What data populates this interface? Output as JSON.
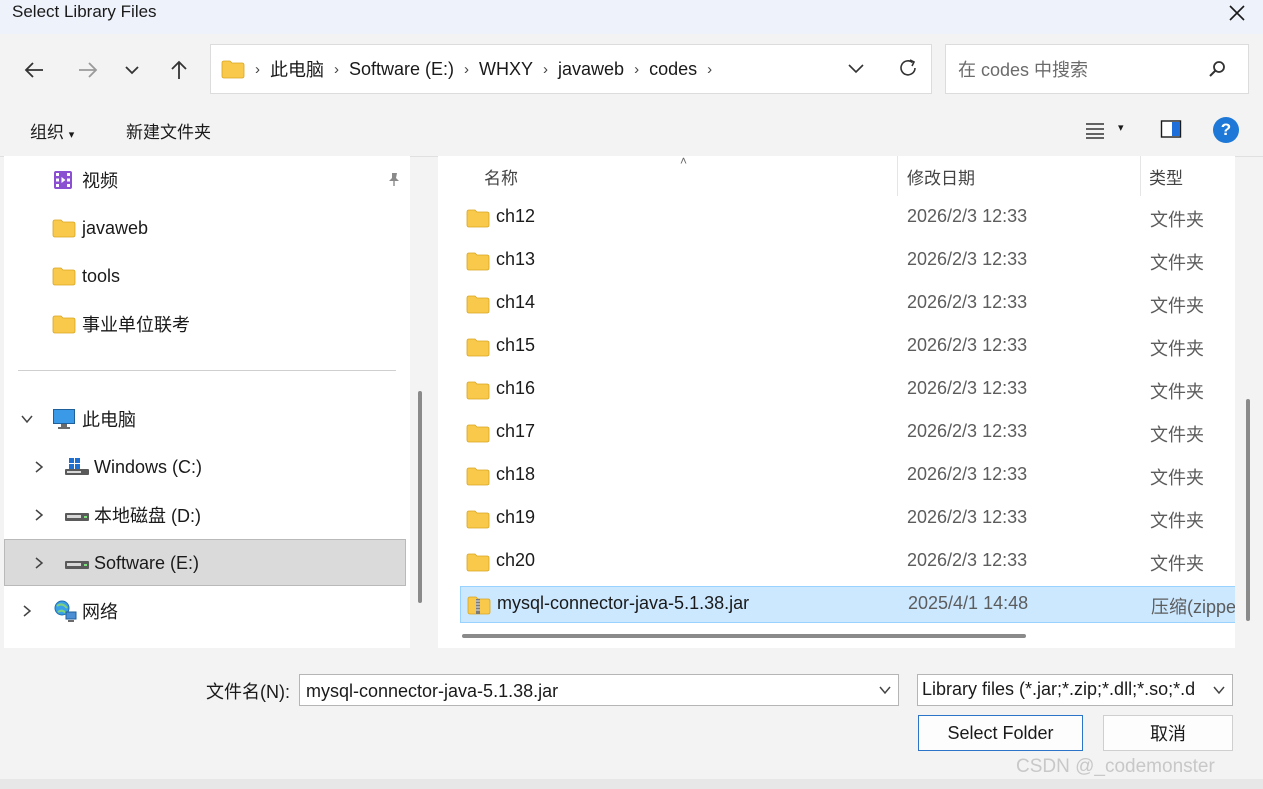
{
  "window": {
    "title": "Select Library Files"
  },
  "address_bar": {
    "crumbs": [
      "此电脑",
      "Software (E:)",
      "WHXY",
      "javaweb",
      "codes"
    ]
  },
  "search": {
    "placeholder": "在 codes 中搜索"
  },
  "command_bar": {
    "organize_label": "组织",
    "new_folder_label": "新建文件夹"
  },
  "sidebar": {
    "quick_access": [
      {
        "label": "视频",
        "icon": "video-folder-icon"
      },
      {
        "label": "javaweb",
        "icon": "folder-icon"
      },
      {
        "label": "tools",
        "icon": "folder-icon"
      },
      {
        "label": "事业单位联考",
        "icon": "folder-icon"
      }
    ],
    "this_pc": {
      "label": "此电脑",
      "icon": "computer-icon"
    },
    "drives": [
      {
        "label": "Windows (C:)",
        "icon": "windows-drive-icon"
      },
      {
        "label": "本地磁盘 (D:)",
        "icon": "drive-icon"
      },
      {
        "label": "Software (E:)",
        "icon": "drive-icon",
        "selected": true
      }
    ],
    "network": {
      "label": "网络",
      "icon": "network-icon"
    }
  },
  "file_list": {
    "columns": {
      "name": "名称",
      "modified": "修改日期",
      "type": "类型"
    },
    "rows": [
      {
        "name": "ch12",
        "modified": "2026/2/3 12:33",
        "type": "文件夹",
        "icon": "folder-icon"
      },
      {
        "name": "ch13",
        "modified": "2026/2/3 12:33",
        "type": "文件夹",
        "icon": "folder-icon"
      },
      {
        "name": "ch14",
        "modified": "2026/2/3 12:33",
        "type": "文件夹",
        "icon": "folder-icon"
      },
      {
        "name": "ch15",
        "modified": "2026/2/3 12:33",
        "type": "文件夹",
        "icon": "folder-icon"
      },
      {
        "name": "ch16",
        "modified": "2026/2/3 12:33",
        "type": "文件夹",
        "icon": "folder-icon"
      },
      {
        "name": "ch17",
        "modified": "2026/2/3 12:33",
        "type": "文件夹",
        "icon": "folder-icon"
      },
      {
        "name": "ch18",
        "modified": "2026/2/3 12:33",
        "type": "文件夹",
        "icon": "folder-icon"
      },
      {
        "name": "ch19",
        "modified": "2026/2/3 12:33",
        "type": "文件夹",
        "icon": "folder-icon"
      },
      {
        "name": "ch20",
        "modified": "2026/2/3 12:33",
        "type": "文件夹",
        "icon": "folder-icon"
      },
      {
        "name": "mysql-connector-java-5.1.38.jar",
        "modified": "2025/4/1 14:48",
        "type": "压缩(zippe",
        "icon": "zip-file-icon",
        "selected": true
      }
    ]
  },
  "bottom": {
    "filename_label": "文件名(N):",
    "filename_value": "mysql-connector-java-5.1.38.jar",
    "filter_value": "Library files (*.jar;*.zip;*.dll;*.so;*.d",
    "select_folder_label": "Select Folder",
    "cancel_label": "取消"
  },
  "watermark": "CSDN @_codemonster",
  "colors": {
    "accent": "#2b74c7",
    "selection": "#cce8ff",
    "folder": "#f8c94a"
  }
}
